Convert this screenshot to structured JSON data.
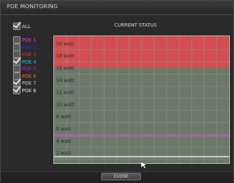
{
  "window": {
    "title": "POE MONITORING"
  },
  "header": {
    "all_label": "ALL",
    "all_checked": true,
    "status_title": "CURRENT STATUS"
  },
  "ports": [
    {
      "label": "POE 1",
      "color": "#e040e0",
      "checked": false
    },
    {
      "label": "POE 2",
      "color": "#2a2ae0",
      "checked": false
    },
    {
      "label": "POE 3",
      "color": "#e03030",
      "checked": false
    },
    {
      "label": "POE 4",
      "color": "#20d0d0",
      "checked": true
    },
    {
      "label": "POE 5",
      "color": "#c020c0",
      "checked": false
    },
    {
      "label": "POE 6",
      "color": "#e07030",
      "checked": false
    },
    {
      "label": "POE 7",
      "color": "#c8c8c8",
      "checked": true
    },
    {
      "label": "POE 8",
      "color": "#e8e8e8",
      "checked": true
    }
  ],
  "chart_data": {
    "type": "line",
    "y_labels": [
      "20 watt",
      "18 watt",
      "16 watt",
      "14 watt",
      "12 watt",
      "10 watt",
      "8 watt",
      "6 watt",
      "4 watt",
      "2 watt"
    ],
    "ylim": [
      0,
      20
    ],
    "warning_threshold_watt": 15,
    "colors": {
      "warning_zone": "#d24e52",
      "normal_zone": "#6b786a",
      "grid": "#8e9c8a"
    },
    "series": [
      {
        "color": "#e040e0",
        "values": [
          3.8,
          3.8,
          3.8,
          3.8,
          3.8,
          3.8,
          3.8,
          3.8,
          3.8,
          3.8,
          3.8,
          3.8,
          3.8,
          3.8,
          3.8
        ]
      },
      {
        "color": "#e8e8e8",
        "values": [
          0.4,
          0.4,
          0.4,
          0.4,
          0.4,
          0.4,
          0.4,
          0.4,
          0.4,
          0.4,
          0.4,
          0.4,
          0.4,
          0.4,
          0.4
        ]
      }
    ]
  },
  "footer": {
    "close_label": "CLOSE"
  }
}
